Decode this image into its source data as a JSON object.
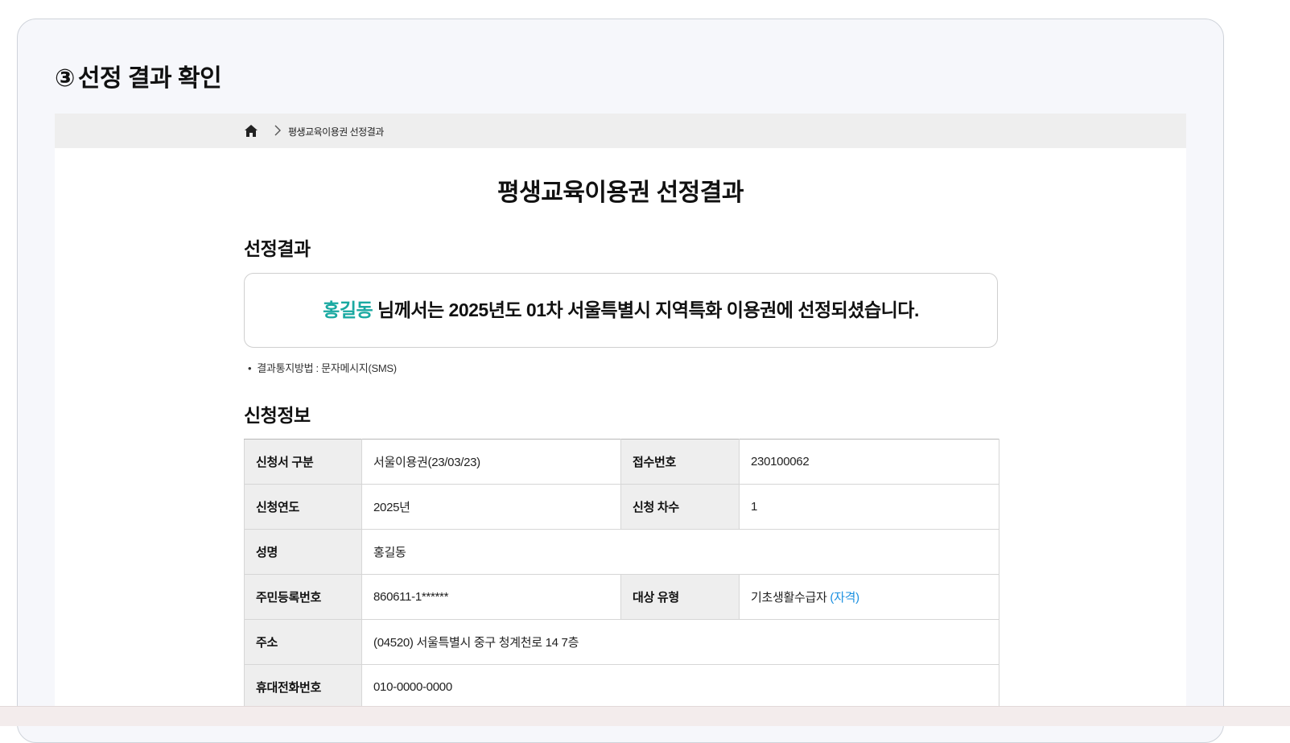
{
  "step": {
    "number": "③",
    "title": "선정 결과 확인"
  },
  "breadcrumb": {
    "home_icon": "home-icon",
    "separator_icon": "chevron-right-icon",
    "current": "평생교육이용권 선정결과"
  },
  "page": {
    "heading": "평생교육이용권 선정결과"
  },
  "result_section": {
    "title": "선정결과",
    "name": "홍길동",
    "message": " 님께서는 2025년도 01차 서울특별시 지역특화 이용권에 선정되셨습니다.",
    "notice_bullet": "•",
    "notice": "결과통지방법 : 문자메시지(SMS)"
  },
  "applicant_section": {
    "title": "신청정보",
    "rows": {
      "form_type_label": "신청서 구분",
      "form_type_value": "서울이용권(23/03/23)",
      "receipt_no_label": "접수번호",
      "receipt_no_value": "230100062",
      "year_label": "신청연도",
      "year_value": "2025년",
      "round_label": "신청 차수",
      "round_value": "1",
      "name_label": "성명",
      "name_value": "홍길동",
      "rrn_label": "주민등록번호",
      "rrn_value": "860611-1******",
      "target_type_label": "대상 유형",
      "target_type_value": "기초생활수급자",
      "target_type_link": " (자격)",
      "address_label": "주소",
      "address_value": "(04520) 서울특별시 중구 청계천로 14 7층",
      "phone_label": "휴대전화번호",
      "phone_value": "010-0000-0000"
    }
  },
  "colors": {
    "accent_name": "#1aa9a1",
    "link": "#1a8fe0",
    "table_header_bg": "#eeeeee",
    "breadcrumb_bg": "#eeeeee"
  }
}
